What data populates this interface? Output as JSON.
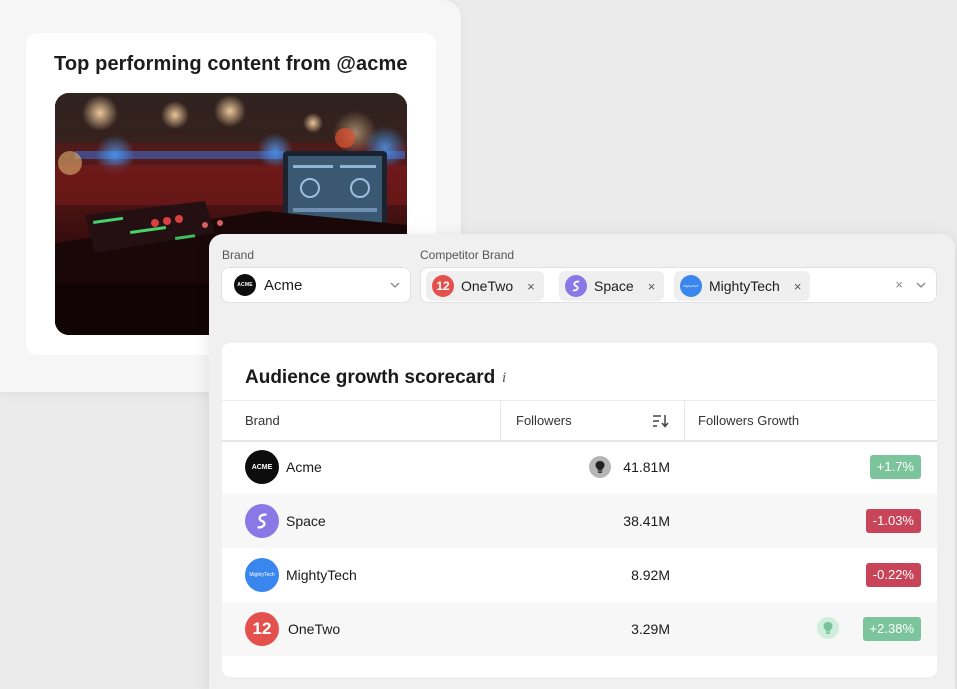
{
  "content_card": {
    "title": "Top performing content from @acme"
  },
  "filters": {
    "brand_label": "Brand",
    "brand_value": "Acme",
    "competitor_label": "Competitor Brand",
    "competitors": [
      {
        "name": "OneTwo",
        "logo": "onetwo-logo"
      },
      {
        "name": "Space",
        "logo": "space-logo"
      },
      {
        "name": "MightyTech",
        "logo": "mightytech-logo"
      }
    ],
    "remove_glyph": "×",
    "clear_glyph": "×"
  },
  "scorecard": {
    "title": "Audience growth scorecard",
    "info_glyph": "i",
    "columns": {
      "brand": "Brand",
      "followers": "Followers",
      "growth": "Followers Growth"
    },
    "rows": [
      {
        "brand": "Acme",
        "followers": "41.81M",
        "growth": "+1.7%",
        "trend": "up",
        "insight": true
      },
      {
        "brand": "Space",
        "followers": "38.41M",
        "growth": "-1.03%",
        "trend": "down",
        "insight": false
      },
      {
        "brand": "MightyTech",
        "followers": "8.92M",
        "growth": "-0.22%",
        "trend": "down",
        "insight": false
      },
      {
        "brand": "OneTwo",
        "followers": "3.29M",
        "growth": "+2.38%",
        "trend": "up",
        "insight": true
      }
    ]
  },
  "logo_text": {
    "acme": "ACME",
    "mightytech": "MightyTech",
    "onetwo": "12"
  },
  "colors": {
    "positive": "#7cc59c",
    "negative": "#c84458",
    "acme": "#0d0d0d",
    "space": "#8a78e6",
    "mightytech": "#3a86ef",
    "onetwo": "#e4514d"
  }
}
